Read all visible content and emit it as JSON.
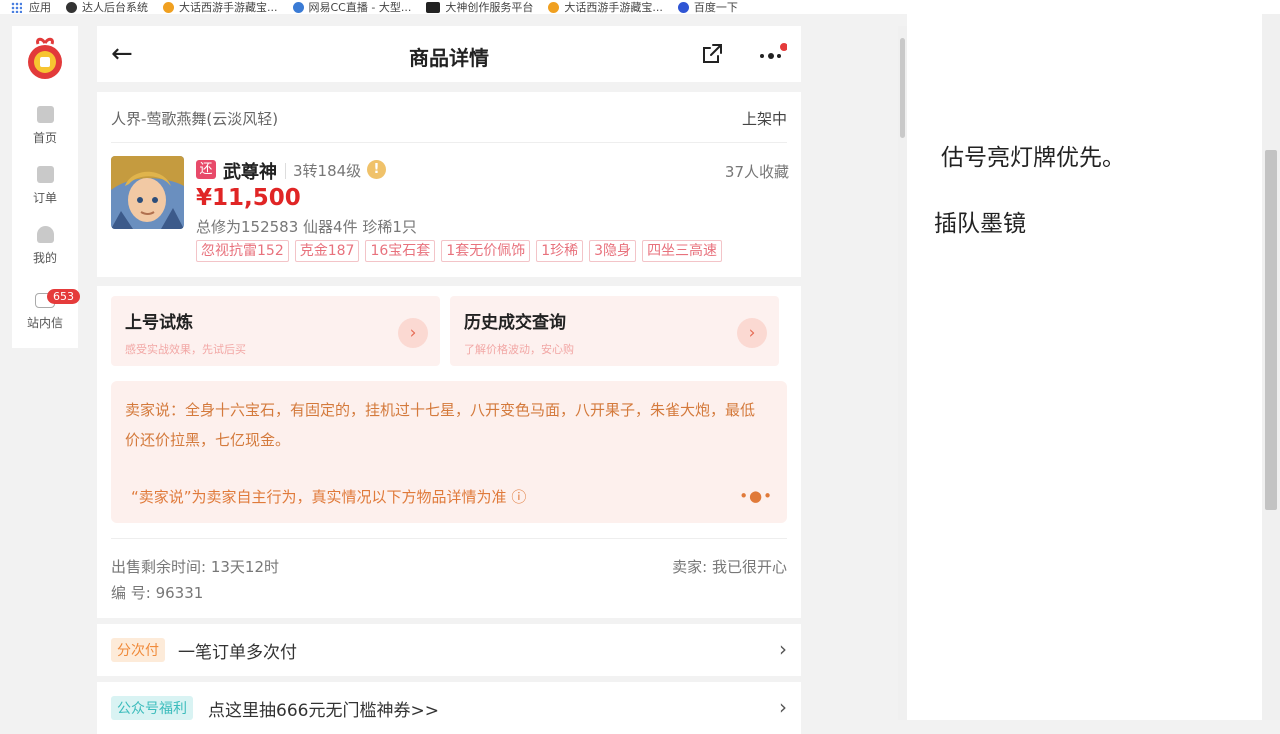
{
  "bookmarks": [
    {
      "label": "应用",
      "icon": "apps-grid-icon"
    },
    {
      "label": "达人后台系统",
      "icon": "globe-icon",
      "color": "#333333"
    },
    {
      "label": "大话西游手游藏宝...",
      "icon": "treasure-icon",
      "color": "#f0a020"
    },
    {
      "label": "网易CC直播 - 大型...",
      "icon": "cc-live-icon",
      "color": "#3a7bd5"
    },
    {
      "label": "大神创作服务平台",
      "icon": "dashen-icon",
      "color": "#222222"
    },
    {
      "label": "大话西游手游藏宝...",
      "icon": "treasure-icon",
      "color": "#f0a020"
    },
    {
      "label": "百度一下",
      "icon": "baidu-paw-icon",
      "color": "#2f55d4"
    }
  ],
  "nav": {
    "items": [
      {
        "label": "首页",
        "icon": "home-icon"
      },
      {
        "label": "订单",
        "icon": "order-icon"
      },
      {
        "label": "我的",
        "icon": "user-icon"
      },
      {
        "label": "站内信",
        "icon": "mail-icon",
        "badge": "653"
      }
    ]
  },
  "header": {
    "title": "商品详情",
    "back_icon": "back-arrow-icon",
    "share_icon": "share-icon",
    "more_icon": "more-icon"
  },
  "item": {
    "server": "人界-莺歌燕舞(云淡风轻)",
    "status": "上架中",
    "return_tag": "还",
    "name": "武尊神",
    "level": "3转184级",
    "warn_icon": "!",
    "favorites": "37人收藏",
    "price": "¥11,500",
    "stats": "总修为152583  仙器4件  珍稀1只",
    "tags": [
      "忽视抗雷152",
      "克金187",
      "16宝石套",
      "1套无价佩饰",
      "1珍稀",
      "3隐身",
      "四坐三高速"
    ]
  },
  "actions": [
    {
      "title": "上号试炼",
      "subtitle": "感受实战效果，先试后买"
    },
    {
      "title": "历史成交查询",
      "subtitle": "了解价格波动，安心购"
    }
  ],
  "seller_says": {
    "text": "卖家说：全身十六宝石，有固定的，挂机过十七星，八开变色马面，八开果子，朱雀大炮，最低价还价拉黑，七亿现金。",
    "note": "“卖家说”为卖家自主行为，真实情况以下方物品详情为准 ⓘ",
    "dots": "•●•"
  },
  "meta": {
    "remaining": "出售剩余时间: 13天12时",
    "seller": "卖家: 我已很开心",
    "id": "编 号: 96331"
  },
  "rows": [
    {
      "tag": "分次付",
      "text": "一笔订单多次付",
      "tag_bg": "#fdebd9",
      "tag_color": "#f08a3a"
    },
    {
      "tag": "公众号福利",
      "text": "点这里抽666元无门槛神券>>",
      "tag_bg": "#d9f3f3",
      "tag_color": "#3cbcbc"
    }
  ],
  "notes": [
    "估号亮灯牌优先。",
    "插队墨镜"
  ],
  "colors": {
    "accent": "#e02525",
    "badge": "#e53b3b"
  }
}
